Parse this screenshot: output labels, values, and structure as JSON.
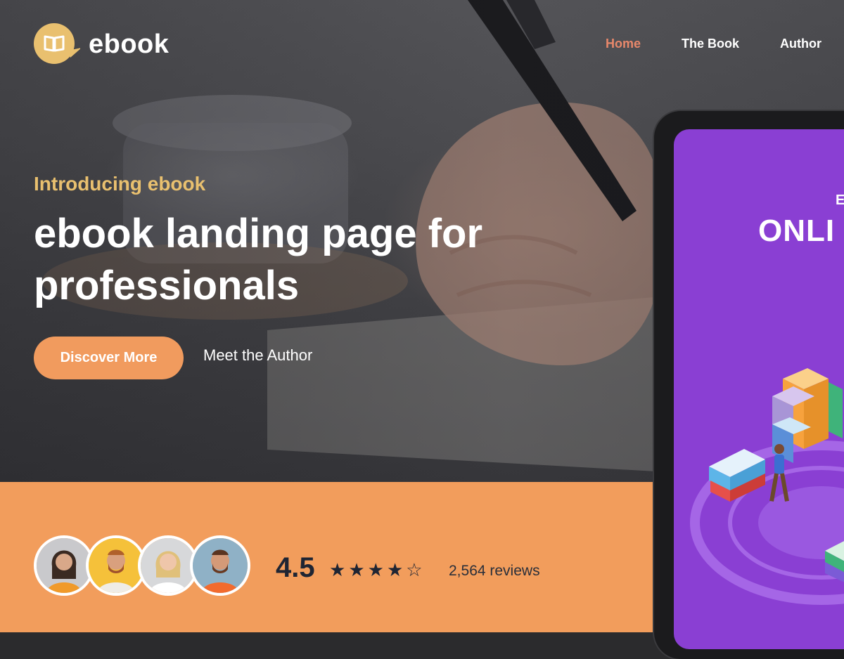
{
  "brand": {
    "name": "ebook"
  },
  "nav": {
    "home": "Home",
    "the_book": "The Book",
    "author": "Author",
    "active": "Home"
  },
  "hero": {
    "eyebrow": "Introducing ebook",
    "headline": "ebook landing page for professionals",
    "primary_button": "Discover More",
    "secondary_link": "Meet the Author"
  },
  "stats": {
    "rating": "4.5",
    "stars_filled": 4,
    "stars_total": 5,
    "reviews": "2,564 reviews"
  },
  "phone_screen": {
    "kicker": "E",
    "title": "ONLI"
  },
  "colors": {
    "accent": "#f19b5e",
    "band": "#f29d5c",
    "eyebrow": "#e9c06f",
    "nav_active": "#e8886b",
    "screen": "#8a3fd3",
    "dark_text": "#1f2533"
  },
  "icons": [
    "open-book-logo-icon",
    "star-icon",
    "star-outline-icon"
  ]
}
